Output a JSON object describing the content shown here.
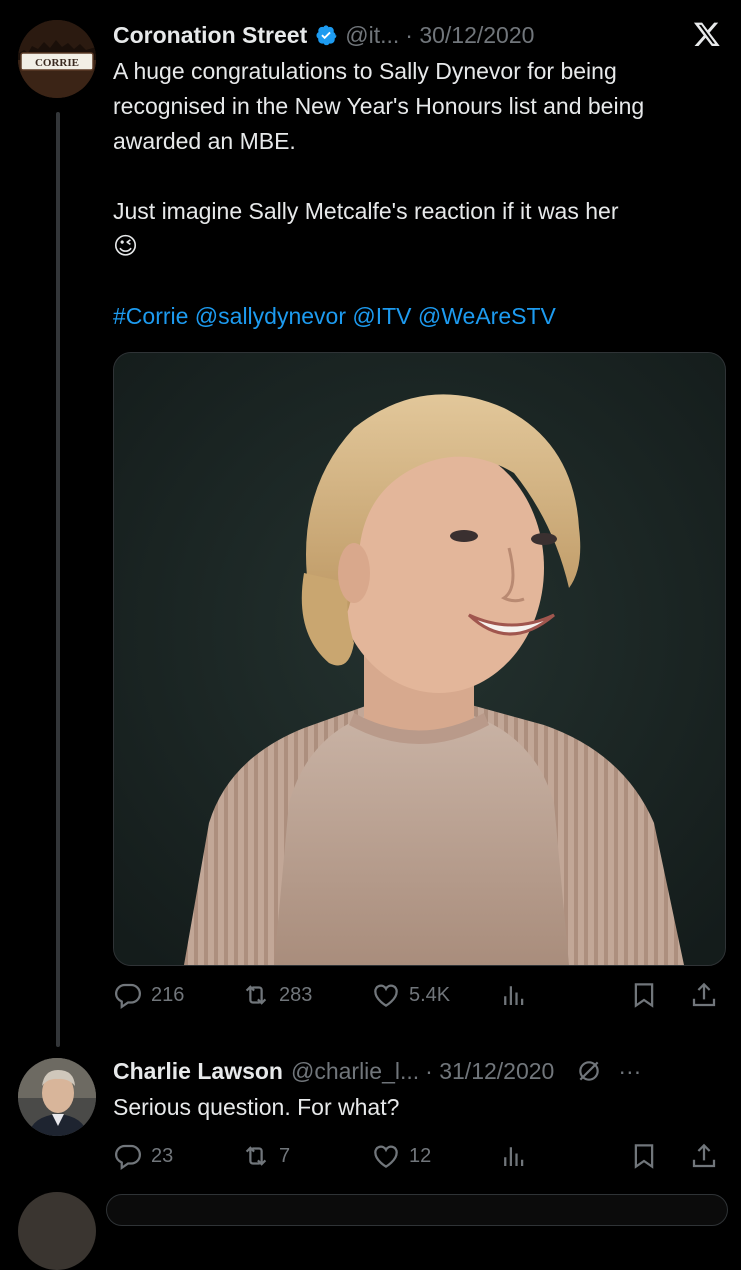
{
  "tweet": {
    "avatar_text": "CORRIE",
    "name": "Coronation Street",
    "handle": "@it...",
    "date": "· 30/12/2020",
    "text_line1": "A huge congratulations to Sally Dynevor for being recognised in the New Year's Honours list and being awarded an MBE.",
    "text_line2": "Just imagine Sally Metcalfe's reaction if it was her",
    "emoji": "😉",
    "links": "#Corrie @sallydynevor @ITV @WeAreSTV",
    "stats": {
      "replies": "216",
      "retweets": "283",
      "likes": "5.4K"
    }
  },
  "reply": {
    "name": "Charlie Lawson",
    "handle": "@charlie_l...",
    "date": "· 31/12/2020",
    "more": "···",
    "text": "Serious question. For what?",
    "stats": {
      "replies": "23",
      "retweets": "7",
      "likes": "12"
    }
  },
  "colors": {
    "background": "#000000",
    "text": "#e7e9ea",
    "muted": "#71767b",
    "link": "#1d9bf0",
    "verified": "#1d9bf0"
  },
  "icons": [
    "verified-badge-icon",
    "x-logo-icon",
    "reply-icon",
    "retweet-icon",
    "like-icon",
    "views-icon",
    "bookmark-icon",
    "share-icon",
    "grok-icon",
    "more-icon"
  ]
}
